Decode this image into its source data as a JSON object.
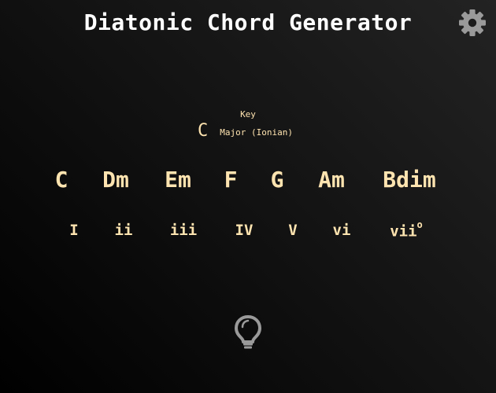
{
  "header": {
    "title": "Diatonic Chord Generator",
    "settings_icon": "gear-icon"
  },
  "key": {
    "label": "Key",
    "note": "C",
    "mode": "Major (Ionian)"
  },
  "chords": [
    "C",
    "Dm",
    "Em",
    "F",
    "G",
    "Am",
    "Bdim"
  ],
  "numerals": [
    {
      "text": "I",
      "sup": ""
    },
    {
      "text": "ii",
      "sup": ""
    },
    {
      "text": "iii",
      "sup": ""
    },
    {
      "text": "IV",
      "sup": ""
    },
    {
      "text": "V",
      "sup": ""
    },
    {
      "text": "vi",
      "sup": ""
    },
    {
      "text": "vii",
      "sup": "o"
    }
  ],
  "footer": {
    "hint_icon": "lightbulb-icon"
  },
  "colors": {
    "text": "#ffe4b0",
    "title": "#ffffff",
    "icon": "#9a9a9a"
  }
}
